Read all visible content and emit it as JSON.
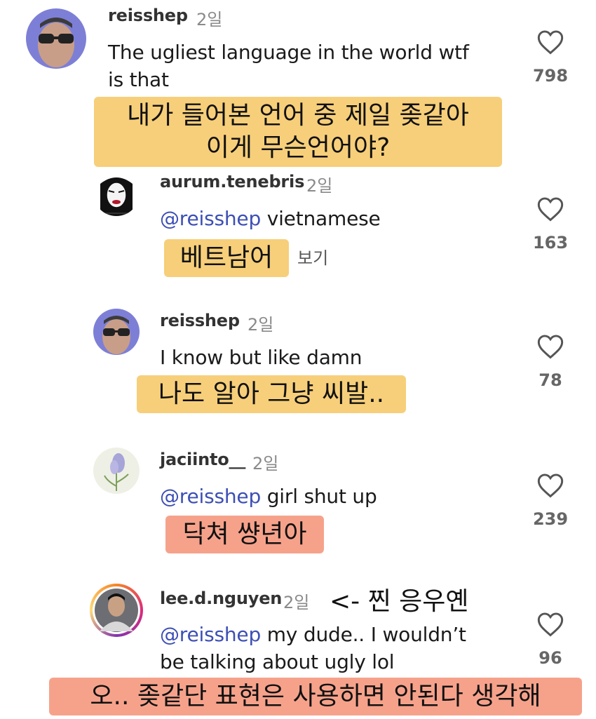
{
  "comments": [
    {
      "username": "reisshep",
      "time": "2일",
      "text": "The ugliest language in the world wtf\nis that",
      "likes": "798",
      "translation": "내가 들어본 언어 중 제일 좆같아\n이게 무슨언어야?"
    },
    {
      "username": "aurum.tenebris",
      "time": "2일",
      "mention": "@reisshep",
      "text": " vietnamese",
      "likes": "163",
      "hidden_label": "보기",
      "translation": "베트남어"
    },
    {
      "username": "reisshep",
      "time": "2일",
      "text": "I know but like damn",
      "likes": "78",
      "translation": "나도 알아 그냥 씨발.."
    },
    {
      "username": "jaciinto__",
      "time": "2일",
      "mention": "@reisshep",
      "text": " girl shut up",
      "likes": "239",
      "translation": "닥쳐 썅년아"
    },
    {
      "username": "lee.d.nguyen",
      "time": "2일",
      "mention": "@reisshep",
      "text": " my dude.. I wouldn’t\nbe talking about ugly lol",
      "likes": "96",
      "note": "<- 찐 응우옌",
      "translation": "오.. 좆같단 표현은 사용하면 안된다 생각해"
    }
  ],
  "colors": {
    "highlight_yellow": "#f7cf7a",
    "highlight_red": "#f6a28b",
    "mention": "#3d4fb5"
  },
  "icons": {
    "like": "heart-outline-icon"
  }
}
